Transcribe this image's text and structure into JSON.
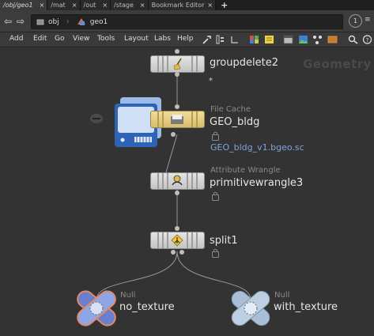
{
  "tabs": [
    {
      "label": "/obj/geo1",
      "close": "×",
      "active": true
    },
    {
      "label": "/mat",
      "close": "×",
      "active": false
    },
    {
      "label": "/out",
      "close": "×",
      "active": false
    },
    {
      "label": "/stage",
      "close": "×",
      "active": false
    },
    {
      "label": "Bookmark Editor",
      "close": "×",
      "active": false
    }
  ],
  "tab_add": "+",
  "pathbar": {
    "back": "⇦",
    "forward": "⇨",
    "crumbs": [
      "obj",
      "geo1"
    ],
    "pin_number": "1",
    "menu": "≡"
  },
  "menu": {
    "items": [
      "Add",
      "Edit",
      "Go",
      "View",
      "Tools",
      "Layout",
      "Labs",
      "Help"
    ]
  },
  "network": {
    "context_label": "Geometry",
    "nodes": {
      "groupdelete": {
        "name": "groupdelete2",
        "group_pattern": "*"
      },
      "filecache": {
        "type": "File Cache",
        "name": "GEO_bldg",
        "path": "GEO_bldg_v1.bgeo.sc"
      },
      "wrangle": {
        "type": "Attribute Wrangle",
        "name": "primitivewrangle3"
      },
      "split": {
        "name": "split1"
      },
      "null_a": {
        "type": "Null",
        "name": "no_texture"
      },
      "null_b": {
        "type": "Null",
        "name": "with_texture"
      }
    }
  },
  "colors": {
    "canvas": "#333333",
    "cache_node": "#e8cf8a",
    "cache_icon": "#7aa6e0",
    "null_active": "#6b7fd0",
    "null_inactive": "#a9bfd8",
    "link": "#7fa4d8"
  }
}
